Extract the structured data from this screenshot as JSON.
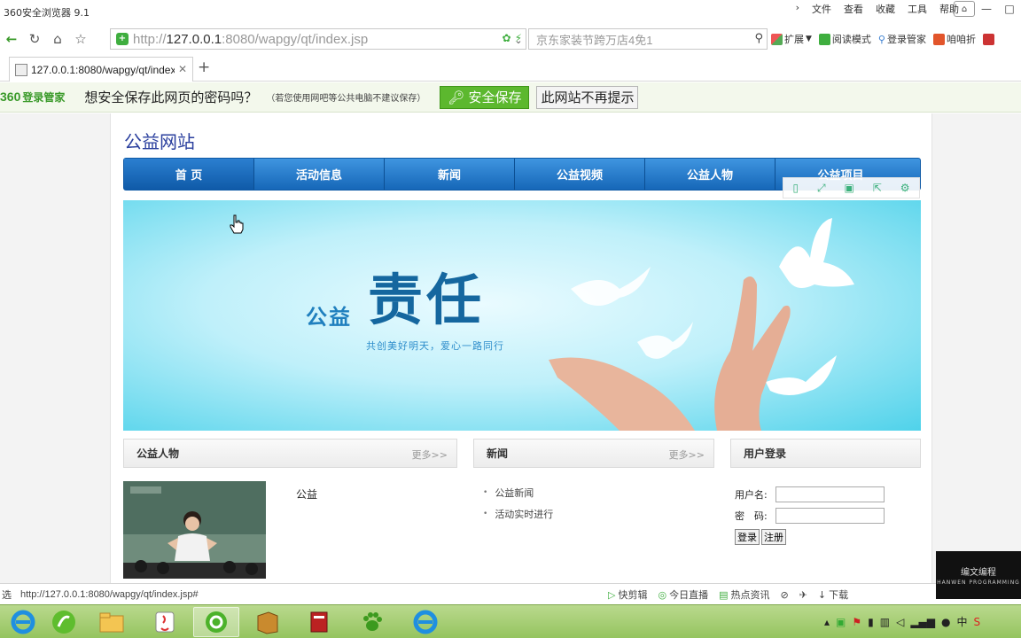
{
  "browser": {
    "app_title": "360安全浏览器 9.1",
    "menus": [
      "文件",
      "查看",
      "收藏",
      "工具",
      "帮助"
    ],
    "address": {
      "scheme": "http://",
      "host": "127.0.0.1",
      "rest": ":8080/wapgy/qt/index.jsp"
    },
    "search_placeholder": "京东家装节跨万店4免1",
    "toolbar_items": [
      "扩展",
      "阅读模式",
      "登录管家",
      "咱咱折"
    ],
    "tab_title": "127.0.0.1:8080/wapgy/qt/index.jsp",
    "password_bar": {
      "logo": "360",
      "logo_sub": "登录管家",
      "question": "想安全保存此网页的密码吗？",
      "hint": "（若您使用网吧等公共电脑不建议保存）",
      "save_label": "安全保存",
      "no_more_label": "此网站不再提示"
    },
    "status": {
      "left": "选",
      "url": "http://127.0.0.1:8080/wapgy/qt/index.jsp#",
      "items": [
        "快剪辑",
        "今日直播",
        "热点资讯",
        "下载"
      ]
    }
  },
  "site": {
    "title": "公益网站",
    "nav": [
      "首 页",
      "活动信息",
      "新闻",
      "公益视频",
      "公益人物",
      "公益项目"
    ],
    "banner": {
      "public": "公益",
      "responsibility": "责任",
      "slogan": "共创美好明天，爱心一路同行"
    },
    "panels": {
      "people": {
        "title": "公益人物",
        "more": "更多>>"
      },
      "news": {
        "title": "新闻",
        "more": "更多>>"
      },
      "login": {
        "title": "用户登录"
      }
    },
    "people_item": {
      "name": "公益"
    },
    "news_items": [
      "公益新闻",
      "活动实时进行"
    ],
    "login_form": {
      "username_label": "用户名:",
      "password_label": "密　码:",
      "login_button": "登录",
      "register_button": "注册"
    }
  },
  "watermark": {
    "title": "编文编程",
    "sub": "HANWEN PROGRAMMING"
  },
  "taskbar": {
    "tray": [
      "中"
    ]
  }
}
